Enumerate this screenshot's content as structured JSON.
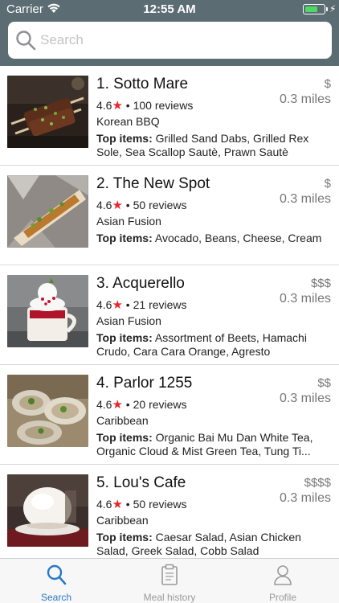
{
  "status_bar": {
    "carrier": "Carrier",
    "time": "12:55 AM",
    "battery_level": 0.7
  },
  "search": {
    "placeholder": "Search",
    "value": ""
  },
  "restaurants": [
    {
      "name": "1. Sotto Mare",
      "rating": "4.6",
      "reviews": "100 reviews",
      "cuisine": "Korean BBQ",
      "top_items_label": "Top items:",
      "top_items": "Grilled Sand Dabs, Grilled Rex Sole, Sea Scallop Sautè, Prawn Sautè",
      "price": "$",
      "distance": "0.3 miles",
      "image": "grilled-skewers-photo"
    },
    {
      "name": "2. The New Spot",
      "rating": "4.6",
      "reviews": "50 reviews",
      "cuisine": "Asian Fusion",
      "top_items_label": "Top items:",
      "top_items": "Avocado, Beans, Cheese, Cream",
      "price": "$",
      "distance": "0.3 miles",
      "image": "bone-marrow-photo"
    },
    {
      "name": "3. Acquerello",
      "rating": "4.6",
      "reviews": "21 reviews",
      "cuisine": "Asian Fusion",
      "top_items_label": "Top items:",
      "top_items": "Assortment of Beets, Hamachi Crudo, Cara Cara Orange, Agresto",
      "price": "$$$",
      "distance": "0.3 miles",
      "image": "dessert-cup-photo"
    },
    {
      "name": "4. Parlor 1255",
      "rating": "4.6",
      "reviews": "20 reviews",
      "cuisine": "Caribbean",
      "top_items_label": "Top items:",
      "top_items": "Organic Bai Mu Dan White Tea, Organic Cloud & Mist Green Tea, Tung Ti...",
      "price": "$$",
      "distance": "0.3 miles",
      "image": "oysters-photo"
    },
    {
      "name": "5. Lou's Cafe",
      "rating": "4.6",
      "reviews": "50 reviews",
      "cuisine": "Caribbean",
      "top_items_label": "Top items:",
      "top_items": "Caesar Salad, Asian Chicken Salad, Greek Salad, Cobb Salad",
      "price": "$$$$",
      "distance": "0.3 miles",
      "image": "ice-cream-photo"
    }
  ],
  "tabbar": {
    "tabs": [
      {
        "label": "Search",
        "icon": "search-icon",
        "active": true
      },
      {
        "label": "Meal history",
        "icon": "clipboard-icon",
        "active": false
      },
      {
        "label": "Profile",
        "icon": "person-icon",
        "active": false
      }
    ]
  },
  "colors": {
    "header": "#5b6c73",
    "accent": "#2a79c8",
    "star": "#e8262d",
    "battery": "#4cd964"
  }
}
